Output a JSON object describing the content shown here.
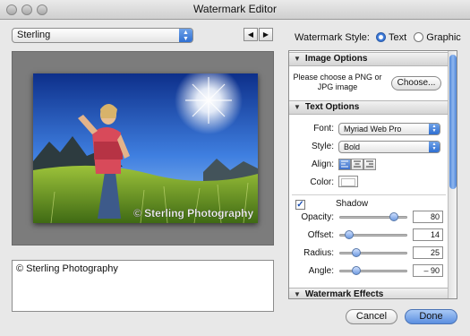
{
  "window": {
    "title": "Watermark Editor"
  },
  "preset": {
    "selected": "Sterling"
  },
  "nav": {
    "prev_icon": "◀",
    "next_icon": "▶"
  },
  "watermark_style": {
    "label": "Watermark Style:",
    "options": [
      {
        "label": "Text",
        "selected": true
      },
      {
        "label": "Graphic",
        "selected": false
      }
    ]
  },
  "preview": {
    "watermark_text": "© Sterling Photography"
  },
  "text_field": {
    "value": "© Sterling Photography"
  },
  "image_options": {
    "header": "Image Options",
    "message": "Please choose a PNG or JPG image",
    "choose_label": "Choose..."
  },
  "text_options": {
    "header": "Text Options",
    "font_label": "Font:",
    "font_value": "Myriad Web Pro",
    "style_label": "Style:",
    "style_value": "Bold",
    "align_label": "Align:",
    "color_label": "Color:"
  },
  "shadow": {
    "label": "Shadow",
    "checked": true,
    "rows": [
      {
        "label": "Opacity:",
        "value": "80",
        "fraction": 0.8
      },
      {
        "label": "Offset:",
        "value": "14",
        "fraction": 0.14
      },
      {
        "label": "Radius:",
        "value": "25",
        "fraction": 0.25
      },
      {
        "label": "Angle:",
        "value": "– 90",
        "fraction": 0.25
      }
    ]
  },
  "watermark_effects": {
    "header": "Watermark Effects"
  },
  "footer": {
    "cancel_label": "Cancel",
    "done_label": "Done"
  },
  "colors": {
    "accent": "#3a78d8",
    "done_button": "#6f9fe6"
  }
}
